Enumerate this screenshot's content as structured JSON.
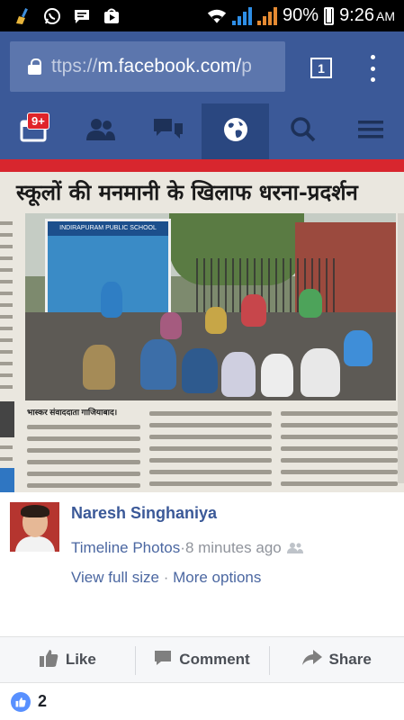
{
  "status_bar": {
    "battery": "90%",
    "time": "9:26",
    "ampm": "AM",
    "icons": [
      "broom-icon",
      "whatsapp-icon",
      "message-icon",
      "play-store-icon",
      "wifi-icon",
      "signal-icon",
      "battery-icon"
    ]
  },
  "browser": {
    "url_prefix": "ttps://",
    "url_host": "m.facebook.com/",
    "url_tail": "p",
    "tab_count": "1"
  },
  "fb_nav": {
    "notifications_badge": "9+",
    "items": [
      "feed-icon",
      "friends-icon",
      "messages-icon",
      "globe-icon",
      "search-icon",
      "menu-icon"
    ],
    "active": "globe-icon"
  },
  "photo": {
    "headline": "स्कूलों की मनमानी के खिलाफ धरना-प्रदर्शन",
    "byline": "भास्कर संवाददाता गाजियाबाद।"
  },
  "post": {
    "author": "Naresh Singhaniya",
    "album": "Timeline Photos",
    "separator": " · ",
    "time": "8 minutes ago",
    "view_full": "View full size",
    "more_options": "More options"
  },
  "actions": {
    "like": "Like",
    "comment": "Comment",
    "share": "Share"
  },
  "reactions": {
    "count": "2"
  },
  "colors": {
    "facebook_blue": "#3b5998",
    "nav_active": "#2a4780",
    "badge_red": "#e0242a",
    "link": "#4b67a1",
    "meta_grey": "#90949c"
  }
}
